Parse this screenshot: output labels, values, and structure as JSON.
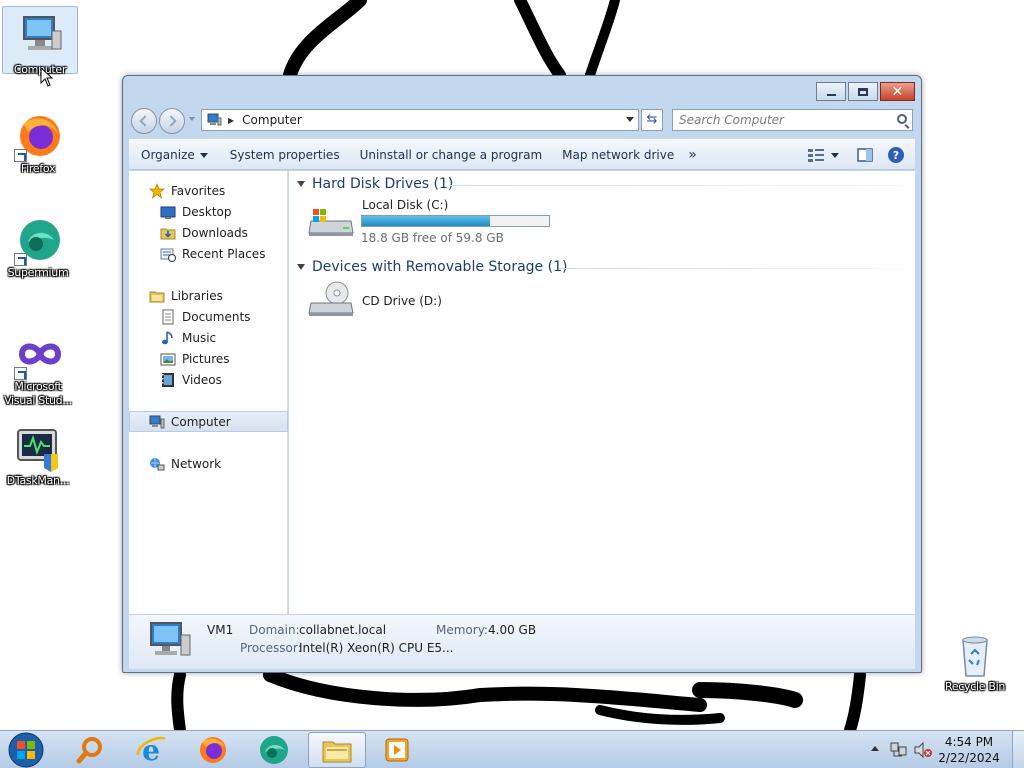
{
  "desktop": {
    "icons": [
      {
        "label": "Computer",
        "icon": "computer-icon"
      },
      {
        "label": "Firefox",
        "icon": "firefox-icon"
      },
      {
        "label": "Supermium",
        "icon": "supermium-icon"
      },
      {
        "label": "Microsoft Visual Stud...",
        "icon": "visual-studio-icon"
      },
      {
        "label": "DTaskMan...",
        "icon": "task-manager-icon"
      },
      {
        "label": "Recycle Bin",
        "icon": "recycle-bin-icon"
      }
    ]
  },
  "window": {
    "address": {
      "location": "Computer"
    },
    "search": {
      "placeholder": "Search Computer"
    },
    "toolbar": {
      "organize": "Organize",
      "system_properties": "System properties",
      "uninstall": "Uninstall or change a program",
      "map_drive": "Map network drive",
      "more": "»"
    },
    "nav": {
      "favorites": "Favorites",
      "desktop": "Desktop",
      "downloads": "Downloads",
      "recent_places": "Recent Places",
      "libraries": "Libraries",
      "documents": "Documents",
      "music": "Music",
      "pictures": "Pictures",
      "videos": "Videos",
      "computer": "Computer",
      "network": "Network"
    },
    "content": {
      "group_hdd": "Hard Disk Drives (1)",
      "group_removable": "Devices with Removable Storage (1)",
      "local_disk": {
        "name": "Local Disk (C:)",
        "free_text": "18.8 GB free of 59.8 GB",
        "used_fraction": 0.686
      },
      "cd_drive": {
        "name": "CD Drive (D:)"
      }
    },
    "details": {
      "name": "VM1",
      "domain_label": "Domain:",
      "domain_value": "collabnet.local",
      "memory_label": "Memory:",
      "memory_value": "4.00 GB",
      "processor_label": "Processor:",
      "processor_value": "Intel(R) Xeon(R) CPU E5..."
    }
  },
  "taskbar": {
    "clock_time": "4:54 PM",
    "clock_date": "2/22/2024"
  },
  "colors": {
    "accent": "#1f8cc4",
    "window_frame": "#c3d7ef",
    "header_text": "#1e3b74"
  }
}
